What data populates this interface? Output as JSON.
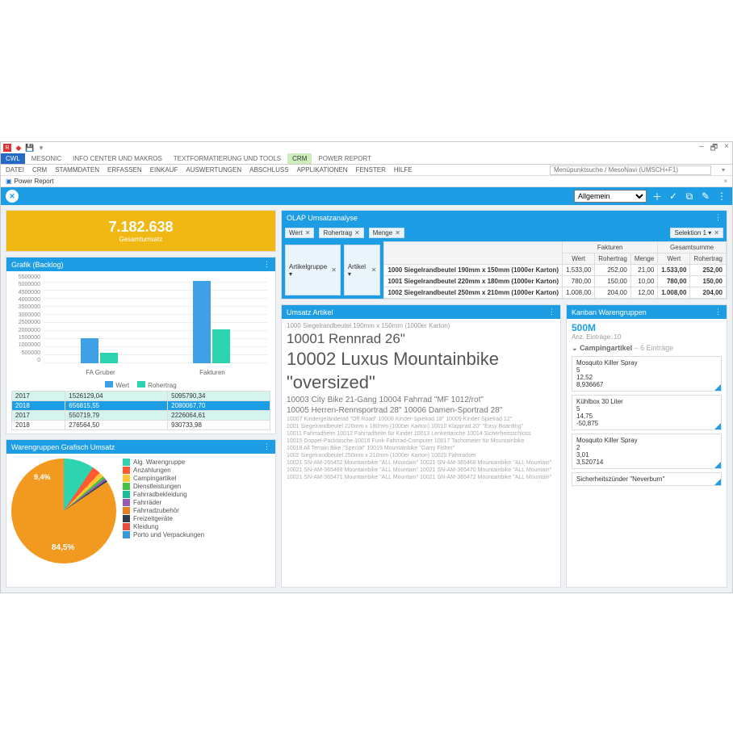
{
  "window": {
    "minimize": "–",
    "maximize": "🗗",
    "close": "×"
  },
  "ribbon": {
    "start": "CWL",
    "tabs": [
      "MESONIC",
      "INFO CENTER UND MAKROS",
      "TEXTFORMATIERUNG UND TOOLS",
      "CRM",
      "POWER REPORT"
    ],
    "active": "CRM"
  },
  "menu": [
    "DATEI",
    "CRM",
    "STAMMDATEN",
    "ERFASSEN",
    "EINKAUF",
    "AUSWERTUNGEN",
    "ABSCHLUSS",
    "APPLIKATIONEN",
    "FENSTER",
    "HILFE"
  ],
  "search_placeholder": "Menüpunktsuche / MesoNavi (UMSCH+F1)",
  "doc_title": "Power Report",
  "toolbar": {
    "select_value": "Allgemein",
    "icons": [
      "plus-icon",
      "check-icon",
      "copy-icon",
      "edit-icon",
      "more-icon"
    ]
  },
  "kpi": {
    "value": "7.182.638",
    "label": "Gesamtumsatz"
  },
  "backlog": {
    "title": "Grafik (Backlog)",
    "ymax": 5500000,
    "yticks": [
      "5500000",
      "5000000",
      "4500000",
      "4000000",
      "3500000",
      "3000000",
      "2500000",
      "2000000",
      "1500000",
      "1000000",
      "500000",
      "0"
    ],
    "categories": [
      "FA Gruber",
      "Fakturen"
    ],
    "series": [
      {
        "name": "Wert",
        "color": "blue",
        "values": [
          1526129,
          5095790
        ]
      },
      {
        "name": "Rohertrag",
        "color": "teal",
        "values": [
          656815,
          2080067
        ]
      }
    ],
    "legend": [
      "Wert",
      "Rohertrag"
    ],
    "table": [
      [
        "2017",
        "1526129,04",
        "5095790,34"
      ],
      [
        "2018",
        "656815,55",
        "2080067,70"
      ],
      [
        "2017",
        "550719,79",
        "2226064,61"
      ],
      [
        "2018",
        "276564,50",
        "930733,98"
      ]
    ]
  },
  "pie": {
    "title": "Warengruppen Grafisch Umsatz",
    "labels": [
      "9,4%",
      "84,5%"
    ],
    "legend": [
      {
        "c": "#2ed3b0",
        "t": "Alg. Warengruppe"
      },
      {
        "c": "#ff5a33",
        "t": "Anzahlungen"
      },
      {
        "c": "#ffc633",
        "t": "Campingartikel"
      },
      {
        "c": "#44c241",
        "t": "Dienstleistungen"
      },
      {
        "c": "#1abc9c",
        "t": "Fahrradbekleidung"
      },
      {
        "c": "#9b59b6",
        "t": "Fahrräder"
      },
      {
        "c": "#e67e22",
        "t": "Fahrradzubehör"
      },
      {
        "c": "#2c3e50",
        "t": "Freizeitgeräte"
      },
      {
        "c": "#e74c3c",
        "t": "Kleidung"
      },
      {
        "c": "#3498db",
        "t": "Porto und Verpackungen"
      }
    ]
  },
  "olap": {
    "title": "OLAP Umsatzanalyse",
    "measures": [
      "Wert",
      "Rohertrag",
      "Menge"
    ],
    "selection": "Selektion 1",
    "dims": [
      "Artikelgruppe",
      "Artikel"
    ],
    "cols": [
      "Fakturen",
      "Gesamtsumme"
    ],
    "subcols": [
      "Wert",
      "Rohertrag",
      "Menge",
      "Wert",
      "Rohertrag"
    ],
    "rows": [
      {
        "label": "1000 Siegelrandbeutel 190mm x 150mm (1000er Karton)",
        "v": [
          "1.533,00",
          "252,00",
          "21,00",
          "1.533,00",
          "252,00"
        ]
      },
      {
        "label": "1001 Siegelrandbeutel 220mm x 180mm (1000er Karton)",
        "v": [
          "780,00",
          "150,00",
          "10,00",
          "780,00",
          "150,00"
        ]
      },
      {
        "label": "1002 Siegelrandbeutel 250mm x 210mm (1000er Karton)",
        "v": [
          "1.008,00",
          "204,00",
          "12,00",
          "1.008,00",
          "204,00"
        ]
      }
    ]
  },
  "articles": {
    "title": "Umsatz Artikel",
    "items": [
      {
        "cls": "t1",
        "t": "1000 Siegelrandbeutel 190mm x 150mm (1000er Karton)"
      },
      {
        "cls": "t2",
        "t": "10001 Rennrad 26\""
      },
      {
        "cls": "t3",
        "t": "10002 Luxus Mountainbike \"oversized\""
      },
      {
        "cls": "t4",
        "t": "10003 City Bike 21-Gang   10004 Fahrrad \"MF 1012/rot\""
      },
      {
        "cls": "t4",
        "t": "10005 Herren-Rennsportrad 28\"  10006 Damen-Sportrad 28\""
      },
      {
        "cls": "t5",
        "t": "10007 Kindergeländerad \"Off Road\"   10008 Kinder-Spielrad 18\"   10009 Kinder-Spielrad 12\""
      },
      {
        "cls": "t5",
        "t": "1001 Siegelrandbeutel 220mm x 180mm (1000er Karton)   10010 Klapprad 20\" \"Easy Boarding\""
      },
      {
        "cls": "t5",
        "t": "10011 Fahrradhelm   10012 Fahrradhelm für Kinder   10013 Lenkertasche   10014 Sicherheitsschloss"
      },
      {
        "cls": "t5",
        "t": "10015 Doppel-Packtasche   10016 Funk-Fahrrad-Computer   10017 Tachometer für Mountainbike"
      },
      {
        "cls": "t5",
        "t": "10018 All Terrain Bike \"Special\"   10019 Mountainbike \"Garry Fisher\""
      },
      {
        "cls": "t5",
        "t": "1002 Siegelrandbeutel 250mm x 210mm (1000er Karton)   10020 Fahrradset"
      },
      {
        "cls": "t5",
        "t": "10021 SN-AM-265452 Mountainbike \"ALL Mountain\"   10021 SN-AM-365468 Mountainbike \"ALL Mountain\""
      },
      {
        "cls": "t5",
        "t": "10021 SN-AM-365469 Mountainbike \"ALL Mountain\"   10021 SN-AM-365470 Mountainbike \"ALL Mountain\""
      },
      {
        "cls": "t5",
        "t": "10021 SN-AM-365471 Mountainbike \"ALL Mountain\"   10021 SN-AM-365472 Mountainbike \"ALL Mountain\""
      }
    ]
  },
  "kanban": {
    "title": "Kanban Warengruppen",
    "head": "500M",
    "sub": "Anz. Einträge: 10",
    "group": "Campingartikel",
    "group_sub": " – 6 Einträge",
    "cards": [
      [
        "Mosquito Killer Spray",
        "5",
        "12,52",
        "8,936667"
      ],
      [
        "Kühlbox 30 Liter",
        "5",
        "14,75",
        "-50,875"
      ],
      [
        "Mosquito Killer Spray",
        "2",
        "3,01",
        "3,520714"
      ],
      [
        "Sicherheitszünder \"Neverburn\"",
        "",
        "",
        ""
      ]
    ]
  },
  "chart_data": [
    {
      "type": "bar",
      "title": "Grafik (Backlog)",
      "categories": [
        "FA Gruber",
        "Fakturen"
      ],
      "series": [
        {
          "name": "Wert",
          "values": [
            1526129,
            5095790
          ]
        },
        {
          "name": "Rohertrag",
          "values": [
            656815,
            2080067
          ]
        }
      ],
      "ylim": [
        0,
        5500000
      ]
    },
    {
      "type": "pie",
      "title": "Warengruppen Grafisch Umsatz",
      "categories": [
        "Alg. Warengruppe",
        "Anzahlungen",
        "Campingartikel",
        "Dienstleistungen",
        "Fahrradbekleidung",
        "Fahrräder",
        "Fahrradzubehör",
        "Freizeitgeräte",
        "Kleidung",
        "Porto und Verpackungen"
      ],
      "values": [
        9.4,
        1.5,
        1.0,
        0.5,
        0.5,
        0.3,
        0.3,
        84.5,
        1.0,
        1.0
      ]
    }
  ]
}
